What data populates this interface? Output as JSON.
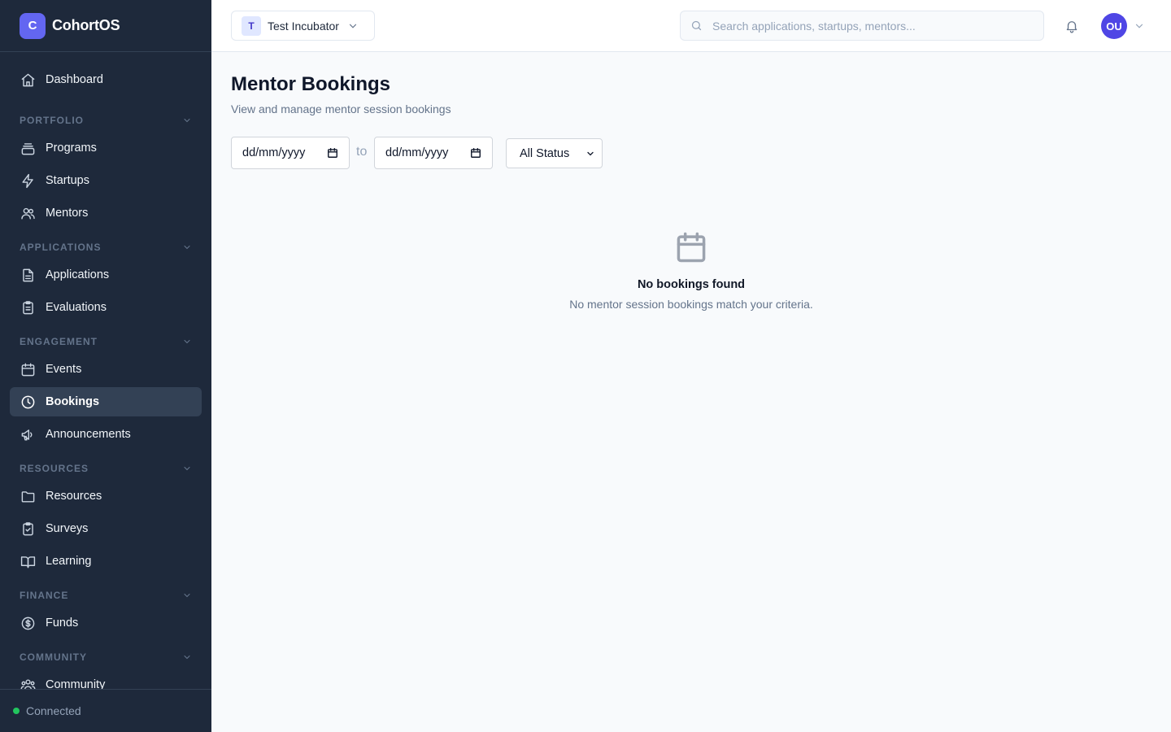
{
  "brand": {
    "logo_letter": "C",
    "name": "CohortOS",
    "accent": "#6366f1"
  },
  "sidebar": {
    "dashboard": "Dashboard",
    "sections": {
      "portfolio": "PORTFOLIO",
      "applications": "APPLICATIONS",
      "engagement": "ENGAGEMENT",
      "resources": "RESOURCES",
      "finance": "FINANCE",
      "community": "COMMUNITY"
    },
    "items": {
      "programs": "Programs",
      "startups": "Startups",
      "mentors": "Mentors",
      "applications": "Applications",
      "evaluations": "Evaluations",
      "events": "Events",
      "bookings": "Bookings",
      "announcements": "Announcements",
      "resources": "Resources",
      "surveys": "Surveys",
      "learning": "Learning",
      "funds": "Funds",
      "community": "Community"
    },
    "active_item": "Bookings",
    "status": {
      "label": "Connected",
      "color": "#22c55e"
    }
  },
  "header": {
    "org": {
      "initial": "T",
      "name": "Test Incubator"
    },
    "search": {
      "placeholder": "Search applications, startups, mentors...",
      "value": ""
    },
    "user": {
      "initials": "OU"
    }
  },
  "main": {
    "title": "Mentor Bookings",
    "subtitle": "View and manage mentor session bookings",
    "filters": {
      "start_date": "dd/mm/yyyy",
      "separator": "to",
      "end_date": "dd/mm/yyyy",
      "status": "All Status"
    },
    "empty_state": {
      "icon": "calendar-icon",
      "title": "No bookings found",
      "description": "No mentor session bookings match your criteria."
    }
  }
}
